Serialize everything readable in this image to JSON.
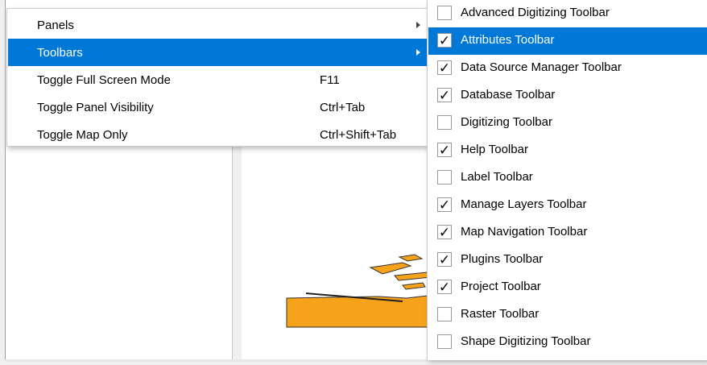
{
  "main_menu": {
    "items": [
      {
        "label": "Panels",
        "shortcut": "",
        "submenu": true
      },
      {
        "label": "Toolbars",
        "shortcut": "",
        "submenu": true,
        "active": true
      },
      {
        "label": "Toggle Full Screen Mode",
        "shortcut": "F11"
      },
      {
        "label": "Toggle Panel Visibility",
        "shortcut": "Ctrl+Tab"
      },
      {
        "label": "Toggle Map Only",
        "shortcut": "Ctrl+Shift+Tab"
      }
    ]
  },
  "toolbars_submenu": {
    "items": [
      {
        "label": "Advanced Digitizing Toolbar",
        "checked": false
      },
      {
        "label": "Attributes Toolbar",
        "checked": true,
        "active": true
      },
      {
        "label": "Data Source Manager Toolbar",
        "checked": true
      },
      {
        "label": "Database Toolbar",
        "checked": true
      },
      {
        "label": "Digitizing Toolbar",
        "checked": false
      },
      {
        "label": "Help Toolbar",
        "checked": true
      },
      {
        "label": "Label Toolbar",
        "checked": false
      },
      {
        "label": "Manage Layers Toolbar",
        "checked": true
      },
      {
        "label": "Map Navigation Toolbar",
        "checked": true
      },
      {
        "label": "Plugins Toolbar",
        "checked": true
      },
      {
        "label": "Project Toolbar",
        "checked": true
      },
      {
        "label": "Raster Toolbar",
        "checked": false
      },
      {
        "label": "Shape Digitizing Toolbar",
        "checked": false
      }
    ]
  },
  "glyphs": {
    "check": "✓"
  },
  "colors": {
    "highlight": "#0078d7",
    "map_feature": "#f7a21b"
  }
}
